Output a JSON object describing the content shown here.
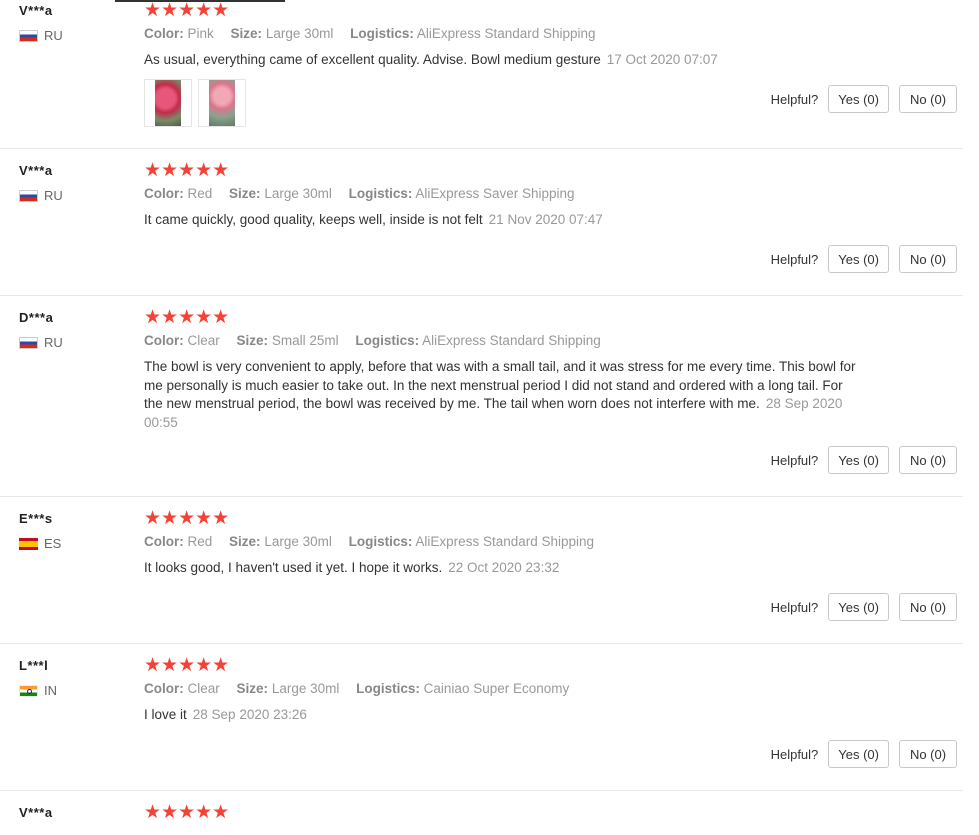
{
  "helpful_label": "Helpful?",
  "reviews": [
    {
      "user": "V***a",
      "country": "RU",
      "stars": "★★★★★",
      "color_label": "Color:",
      "color": "Pink",
      "size_label": "Size:",
      "size": "Large 30ml",
      "logistics_label": "Logistics:",
      "logistics": "AliExpress Standard Shipping",
      "text": "As usual, everything came of excellent quality. Advise. Bowl medium gesture",
      "date": "17 Oct 2020 07:07",
      "yes": "Yes (0)",
      "no": "No (0)"
    },
    {
      "user": "V***a",
      "country": "RU",
      "stars": "★★★★★",
      "color_label": "Color:",
      "color": "Red",
      "size_label": "Size:",
      "size": "Large 30ml",
      "logistics_label": "Logistics:",
      "logistics": "AliExpress Saver Shipping",
      "text": "It came quickly, good quality, keeps well, inside is not felt",
      "date": "21 Nov 2020 07:47",
      "yes": "Yes (0)",
      "no": "No (0)"
    },
    {
      "user": "D***a",
      "country": "RU",
      "stars": "★★★★★",
      "color_label": "Color:",
      "color": "Clear",
      "size_label": "Size:",
      "size": "Small 25ml",
      "logistics_label": "Logistics:",
      "logistics": "AliExpress Standard Shipping",
      "text": "The bowl is very convenient to apply, before that was with a small tail, and it was stress for me every time. This bowl for me personally is much easier to take out. In the next menstrual period I did not stand and ordered with a long tail. For the new menstrual period, the bowl was received by me. The tail when worn does not interfere with me.",
      "date": "28 Sep 2020 00:55",
      "yes": "Yes (0)",
      "no": "No (0)"
    },
    {
      "user": "E***s",
      "country": "ES",
      "stars": "★★★★★",
      "color_label": "Color:",
      "color": "Red",
      "size_label": "Size:",
      "size": "Large 30ml",
      "logistics_label": "Logistics:",
      "logistics": "AliExpress Standard Shipping",
      "text": "It looks good, I haven't used it yet. I hope it works.",
      "date": "22 Oct 2020 23:32",
      "yes": "Yes (0)",
      "no": "No (0)"
    },
    {
      "user": "L***l",
      "country": "IN",
      "stars": "★★★★★",
      "color_label": "Color:",
      "color": "Clear",
      "size_label": "Size:",
      "size": "Large 30ml",
      "logistics_label": "Logistics:",
      "logistics": "Cainiao Super Economy",
      "text": "I love it",
      "date": "28 Sep 2020 23:26",
      "yes": "Yes (0)",
      "no": "No (0)"
    },
    {
      "user": "V***a",
      "stars": "★★★★★"
    }
  ]
}
